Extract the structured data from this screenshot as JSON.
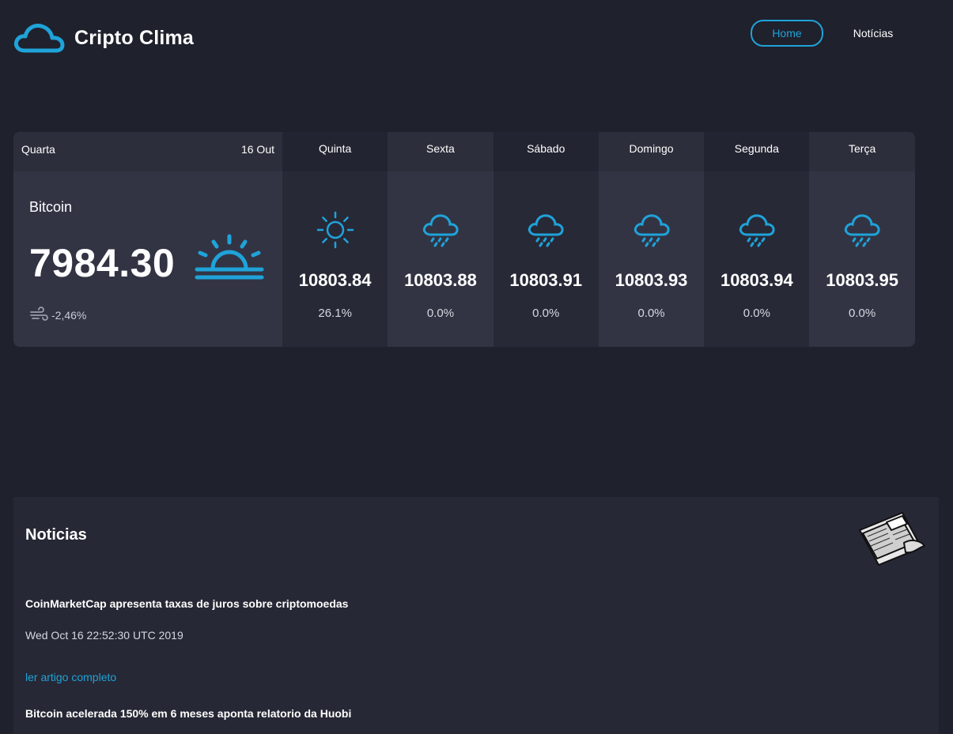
{
  "header": {
    "brand": "Cripto Clima",
    "nav": {
      "home": "Home",
      "news": "Notícias"
    }
  },
  "colors": {
    "accent": "#1fa3d9",
    "background": "#1f212d"
  },
  "today": {
    "day": "Quarta",
    "date": "16 Out",
    "coin": "Bitcoin",
    "price": "7984.30",
    "change": "-2,46%",
    "icon": "sunrise-icon"
  },
  "forecast": [
    {
      "day": "Quinta",
      "price": "10803.84",
      "pct": "26.1%",
      "icon": "sun-icon"
    },
    {
      "day": "Sexta",
      "price": "10803.88",
      "pct": "0.0%",
      "icon": "rain-cloud-icon"
    },
    {
      "day": "Sábado",
      "price": "10803.91",
      "pct": "0.0%",
      "icon": "rain-cloud-icon"
    },
    {
      "day": "Domingo",
      "price": "10803.93",
      "pct": "0.0%",
      "icon": "rain-cloud-icon"
    },
    {
      "day": "Segunda",
      "price": "10803.94",
      "pct": "0.0%",
      "icon": "rain-cloud-icon"
    },
    {
      "day": "Terça",
      "price": "10803.95",
      "pct": "0.0%",
      "icon": "rain-cloud-icon"
    }
  ],
  "news": {
    "title": "Noticias",
    "articles": [
      {
        "title": "CoinMarketCap apresenta taxas de juros sobre criptomoedas",
        "date": "Wed Oct 16 22:52:30 UTC 2019",
        "link": "ler artigo completo"
      },
      {
        "title": "Bitcoin acelerada 150% em 6 meses aponta relatorio da Huobi"
      }
    ]
  }
}
